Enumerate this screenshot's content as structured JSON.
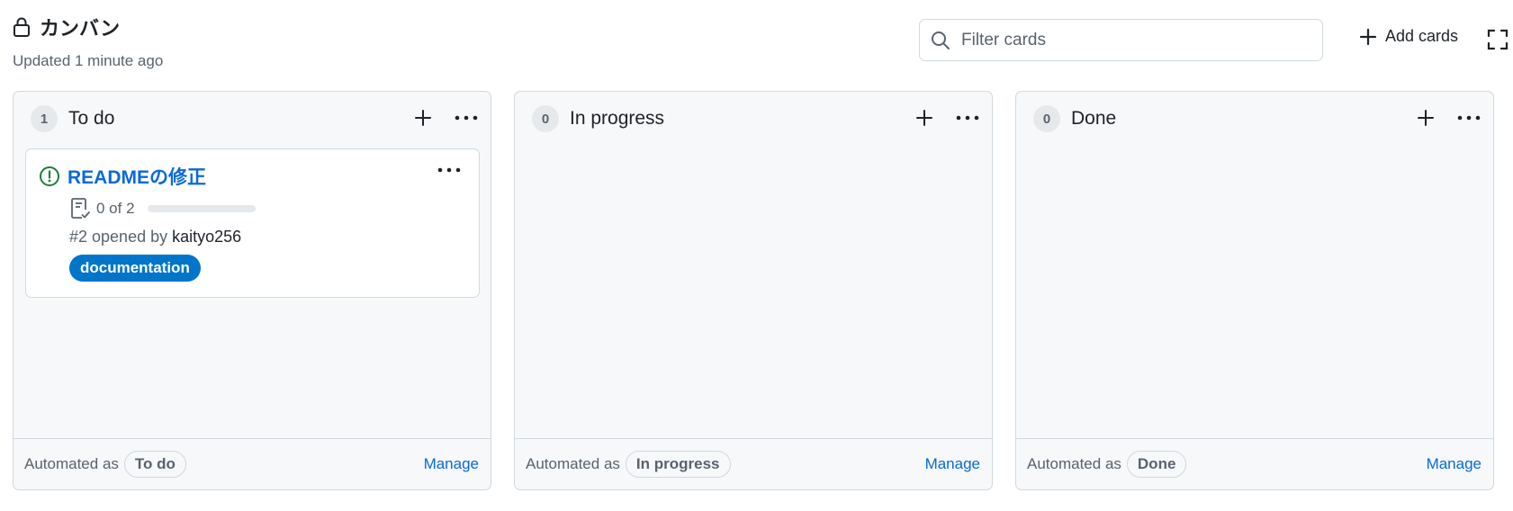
{
  "board": {
    "title": "カンバン",
    "updated": "Updated 1 minute ago"
  },
  "toolbar": {
    "filter_placeholder": "Filter cards",
    "add_cards_label": "Add cards"
  },
  "colors": {
    "link": "#0969da",
    "open_issue": "#1a7f37",
    "label_documentation": "#0075ca",
    "column_bg": "#f6f8fa",
    "border": "#d1d9e0"
  },
  "icons": {
    "lock": "lock-icon",
    "search": "search-icon",
    "plus": "plus-icon",
    "fullscreen": "fullscreen-icon",
    "more": "kebab-horizontal-icon",
    "issue_open": "issue-opened-icon",
    "tasklist": "tasklist-icon"
  },
  "columns": [
    {
      "count": "1",
      "name": "To do",
      "automated_prefix": "Automated as",
      "automation": "To do",
      "manage_label": "Manage",
      "cards": [
        {
          "title": "READMEの修正",
          "tasks_text": "0 of 2",
          "tasks_done": 0,
          "tasks_total": 2,
          "meta_prefix": "#2 opened by ",
          "author": "kaityo256",
          "label": "documentation"
        }
      ]
    },
    {
      "count": "0",
      "name": "In progress",
      "automated_prefix": "Automated as",
      "automation": "In progress",
      "manage_label": "Manage",
      "cards": []
    },
    {
      "count": "0",
      "name": "Done",
      "automated_prefix": "Automated as",
      "automation": "Done",
      "manage_label": "Manage",
      "cards": []
    }
  ]
}
